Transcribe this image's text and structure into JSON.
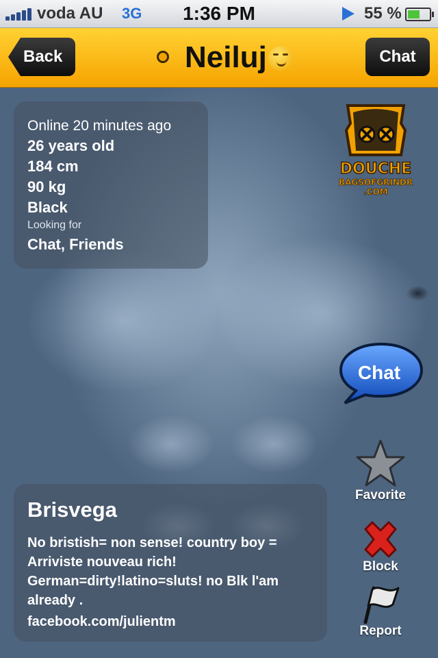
{
  "status_bar": {
    "carrier": "voda AU",
    "network": "3G",
    "time": "1:36 PM",
    "battery": "55 %",
    "battery_level": 0.55
  },
  "nav": {
    "back_label": "Back",
    "title": "Neiluj",
    "chat_label": "Chat",
    "online_status_color": "#f2a200"
  },
  "profile": {
    "online": "Online 20 minutes ago",
    "age": "26 years old",
    "height": "184 cm",
    "weight": "90 kg",
    "ethnicity": "Black",
    "looking_for_label": "Looking for",
    "looking_for": "Chat, Friends"
  },
  "logo": {
    "line1": "DOUCHE",
    "line2": "BAGSOFGRINDR",
    "line3": ".COM"
  },
  "chat_bubble_label": "Chat",
  "actions": {
    "favorite": "Favorite",
    "block": "Block",
    "report": "Report"
  },
  "about": {
    "name": "Brisvega",
    "bio": "No bristish= non sense! country boy = Arriviste nouveau rich! German=dirty!latino=sluts! no Blk l'am already .",
    "link": "facebook.com/julientm"
  },
  "colors": {
    "nav_bar": "#ffc21a",
    "bubble": "#2a6fd6",
    "block_icon": "#d9221c"
  }
}
